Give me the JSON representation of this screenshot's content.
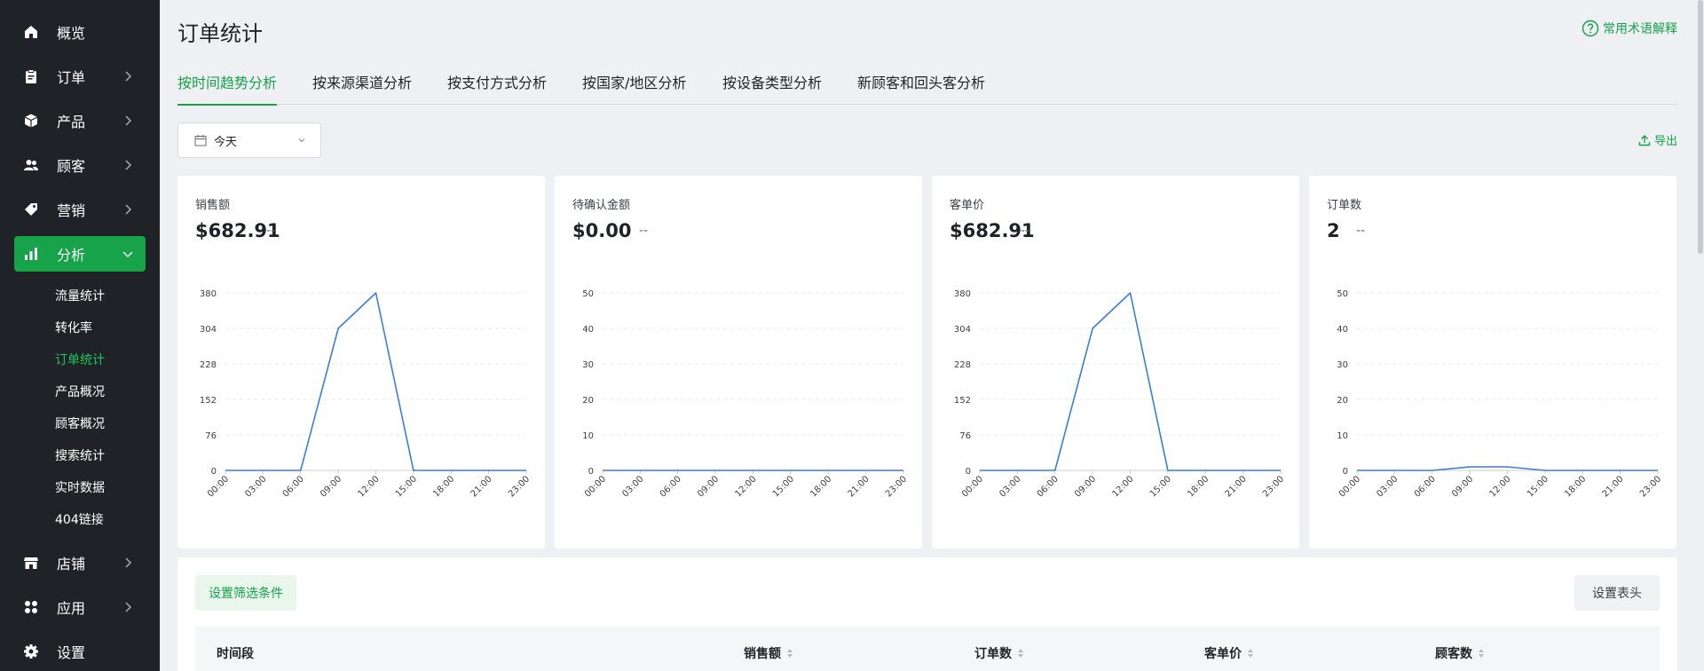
{
  "sidebar": {
    "items": [
      {
        "label": "概览",
        "icon": "home-icon"
      },
      {
        "label": "订单",
        "icon": "clipboard-icon"
      },
      {
        "label": "产品",
        "icon": "box-icon"
      },
      {
        "label": "顾客",
        "icon": "users-icon"
      },
      {
        "label": "营销",
        "icon": "tag-icon"
      },
      {
        "label": "分析",
        "icon": "bar-chart-icon"
      },
      {
        "label": "店铺",
        "icon": "store-icon"
      },
      {
        "label": "应用",
        "icon": "apps-icon"
      },
      {
        "label": "设置",
        "icon": "gear-icon"
      }
    ],
    "active_item": "分析",
    "sub_items": [
      "流量统计",
      "转化率",
      "订单统计",
      "产品概况",
      "顾客概况",
      "搜索统计",
      "实时数据",
      "404链接"
    ],
    "active_sub_item": "订单统计",
    "accent_color": "#16a34a"
  },
  "header": {
    "title": "订单统计",
    "help_link": "常用术语解释"
  },
  "tabs": [
    {
      "label": "按时间趋势分析"
    },
    {
      "label": "按来源渠道分析"
    },
    {
      "label": "按支付方式分析"
    },
    {
      "label": "按国家/地区分析"
    },
    {
      "label": "按设备类型分析"
    },
    {
      "label": "新顾客和回头客分析"
    }
  ],
  "active_tab": "按时间趋势分析",
  "toolbar": {
    "date_range": "今天",
    "export_label": "导出"
  },
  "cards": [
    {
      "label": "销售额",
      "value": "$682.91",
      "delta": "--"
    },
    {
      "label": "待确认金额",
      "value": "$0.00",
      "delta": "--"
    },
    {
      "label": "客单价",
      "value": "$682.91",
      "delta": "--"
    },
    {
      "label": "订单数",
      "value": "2",
      "delta": "--"
    }
  ],
  "chart_data": [
    {
      "type": "line",
      "x": [
        "00:00",
        "03:00",
        "06:00",
        "09:00",
        "12:00",
        "15:00",
        "18:00",
        "21:00",
        "23:00"
      ],
      "y_ticks": [
        "0",
        "76",
        "152",
        "228",
        "304",
        "380"
      ],
      "ylim": [
        0,
        380
      ],
      "series": [
        {
          "values": [
            0,
            0,
            0,
            304,
            380,
            0,
            0,
            0,
            0
          ]
        }
      ],
      "line_color": "#3b7ddd",
      "grid": true
    },
    {
      "type": "line",
      "x": [
        "00:00",
        "03:00",
        "06:00",
        "09:00",
        "12:00",
        "15:00",
        "18:00",
        "21:00",
        "23:00"
      ],
      "y_ticks": [
        "0",
        "10",
        "20",
        "30",
        "40",
        "50"
      ],
      "ylim": [
        0,
        50
      ],
      "series": [
        {
          "values": [
            0,
            0,
            0,
            0,
            0,
            0,
            0,
            0,
            0
          ]
        }
      ],
      "line_color": "#3b7ddd",
      "grid": true
    },
    {
      "type": "line",
      "x": [
        "00:00",
        "03:00",
        "06:00",
        "09:00",
        "12:00",
        "15:00",
        "18:00",
        "21:00",
        "23:00"
      ],
      "y_ticks": [
        "0",
        "76",
        "152",
        "228",
        "304",
        "380"
      ],
      "ylim": [
        0,
        380
      ],
      "series": [
        {
          "values": [
            0,
            0,
            0,
            304,
            380,
            0,
            0,
            0,
            0
          ]
        }
      ],
      "line_color": "#3b7ddd",
      "grid": true
    },
    {
      "type": "line",
      "x": [
        "00:00",
        "03:00",
        "06:00",
        "09:00",
        "12:00",
        "15:00",
        "18:00",
        "21:00",
        "23:00"
      ],
      "y_ticks": [
        "0",
        "10",
        "20",
        "30",
        "40",
        "50"
      ],
      "ylim": [
        0,
        50
      ],
      "series": [
        {
          "values": [
            0,
            0,
            0,
            1,
            1,
            0,
            0,
            0,
            0
          ]
        }
      ],
      "line_color": "#3b7ddd",
      "grid": true
    }
  ],
  "table": {
    "filter_button": "设置筛选条件",
    "header_button": "设置表头",
    "columns": [
      "时间段",
      "销售额",
      "订单数",
      "客单价",
      "顾客数"
    ]
  }
}
